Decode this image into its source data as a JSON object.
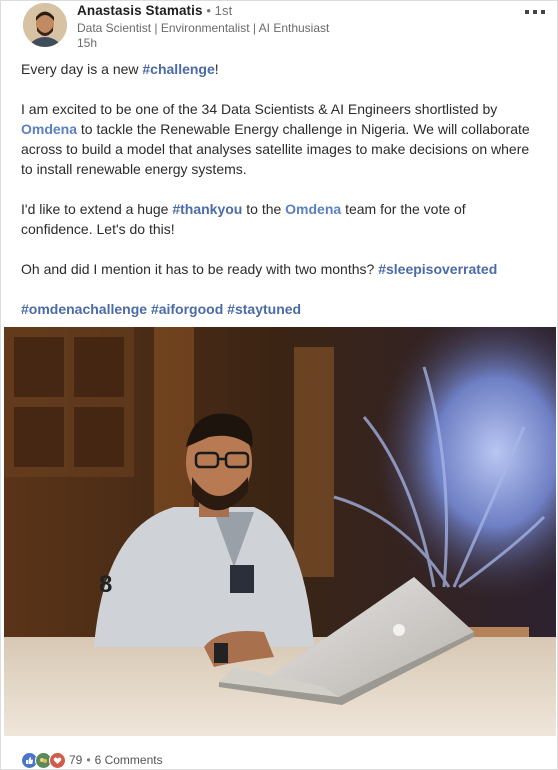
{
  "author": {
    "name": "Anastasis Stamatis",
    "connection": " • 1st",
    "headline": "Data Scientist | Environmentalist | AI Enthusiast",
    "time": "15h"
  },
  "post": {
    "p1": [
      "Every day is a new ",
      "#challenge",
      "!"
    ],
    "p2": [
      "I am excited to be one of the 34 Data Scientists & AI Engineers shortlisted by ",
      "Omdena",
      " to tackle the Renewable Energy challenge in Nigeria. We will collaborate across to build a model that analyses satellite images to make decisions on where to install renewable energy systems."
    ],
    "p3": [
      "I'd like to extend a huge ",
      "#thankyou",
      " to the ",
      "Omdena",
      " team  for the vote of confidence. Let's do this!"
    ],
    "p4": [
      "Oh and did I mention it has to be ready with two months? ",
      "#sleepisoverrated"
    ],
    "p5": [
      "#omdenachallenge",
      " ",
      "#aiforgood",
      "  ",
      "#staytuned"
    ]
  },
  "footer": {
    "reaction_count": "79",
    "separator": "•",
    "comments": "6 Comments"
  },
  "colors": {
    "hashtag": "#4b6aa8",
    "mention": "#5a80bf"
  },
  "icons": [
    "more-options-icon",
    "like-reaction-icon",
    "celebrate-reaction-icon",
    "love-reaction-icon"
  ]
}
